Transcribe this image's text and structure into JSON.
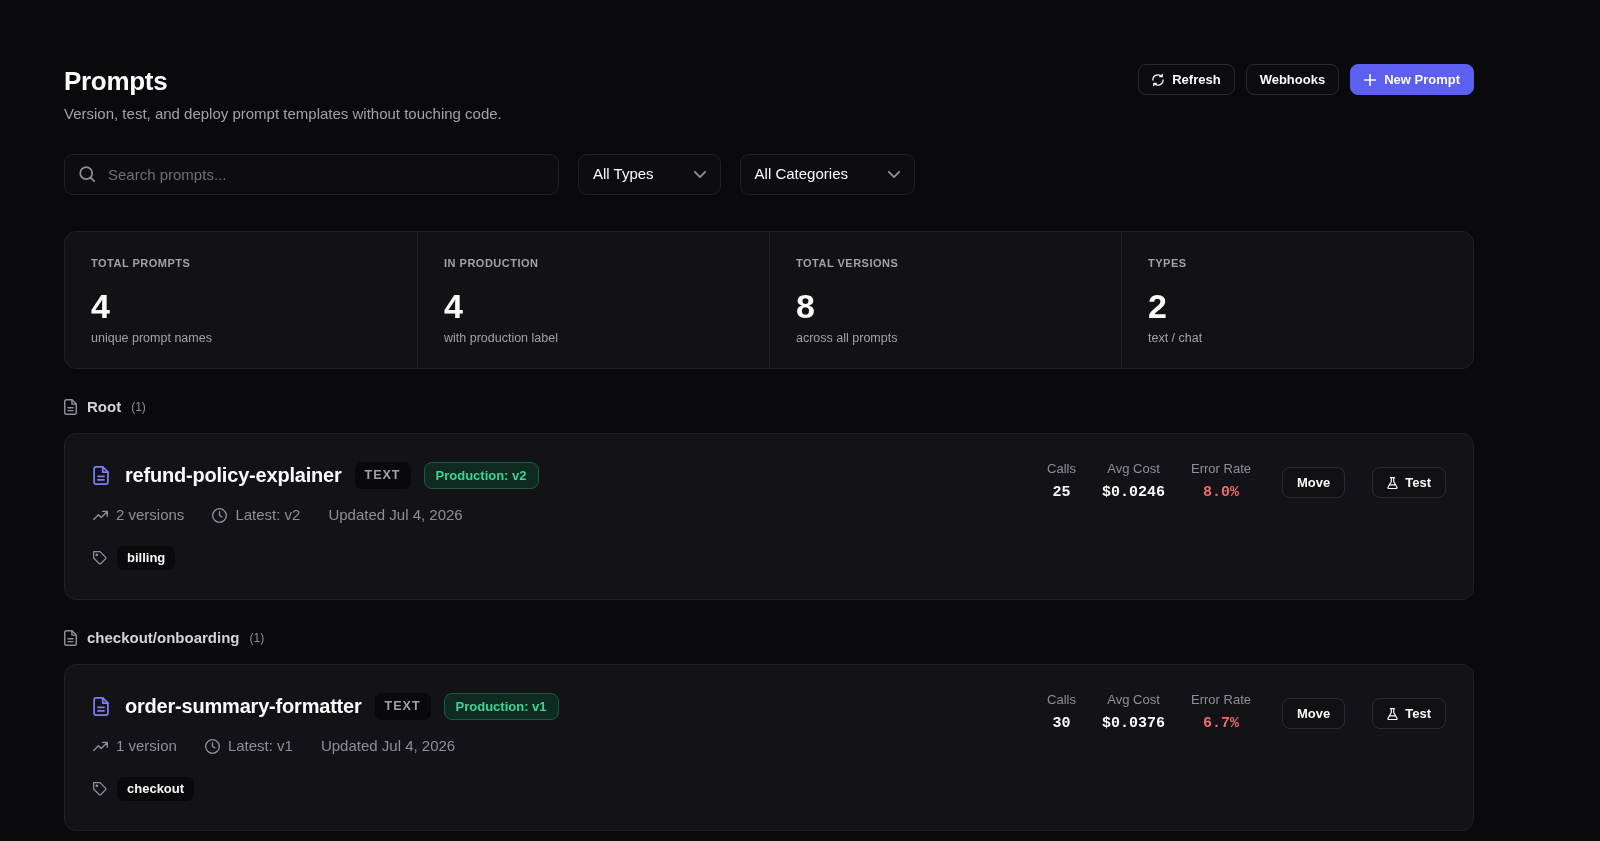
{
  "header": {
    "title": "Prompts",
    "subtitle": "Version, test, and deploy prompt templates without touching code.",
    "buttons": [
      {
        "label": "Refresh",
        "kind": "refresh"
      },
      {
        "label": "Webhooks",
        "kind": "plain"
      },
      {
        "label": "New Prompt",
        "kind": "create"
      }
    ]
  },
  "filters": {
    "search": {
      "placeholder": "Search prompts..."
    },
    "dropdowns": [
      {
        "value": "All Types"
      },
      {
        "value": "All Categories"
      }
    ]
  },
  "stats": [
    {
      "label": "TOTAL PROMPTS",
      "value": "4",
      "caption": "unique prompt names"
    },
    {
      "label": "IN PRODUCTION",
      "value": "4",
      "caption": "with production label"
    },
    {
      "label": "TOTAL VERSIONS",
      "value": "8",
      "caption": "across all prompts"
    },
    {
      "label": "TYPES",
      "value": "2",
      "caption": "text / chat"
    }
  ],
  "groups": [
    {
      "name": "Root",
      "count": "(1)",
      "prompts": [
        {
          "name": "refund-policy-explainer",
          "type": "TEXT",
          "production": "Production: v2",
          "versions": "2 versions",
          "latest": "Latest: v2",
          "updated": "Updated Jul 4, 2026",
          "tags": [
            "billing"
          ],
          "metrics": [
            {
              "label": "Calls",
              "value": "25",
              "kind": "count"
            },
            {
              "label": "Avg Cost",
              "value": "$0.0246",
              "kind": "cost"
            },
            {
              "label": "Error Rate",
              "value": "8.0%",
              "kind": "error"
            }
          ],
          "actions": [
            {
              "label": "Move",
              "kind": "move"
            },
            {
              "label": "Test",
              "kind": "test"
            }
          ]
        }
      ]
    },
    {
      "name": "checkout/onboarding",
      "count": "(1)",
      "prompts": [
        {
          "name": "order-summary-formatter",
          "type": "TEXT",
          "production": "Production: v1",
          "versions": "1 version",
          "latest": "Latest: v1",
          "updated": "Updated Jul 4, 2026",
          "tags": [
            "checkout"
          ],
          "metrics": [
            {
              "label": "Calls",
              "value": "30",
              "kind": "count"
            },
            {
              "label": "Avg Cost",
              "value": "$0.0376",
              "kind": "cost"
            },
            {
              "label": "Error Rate",
              "value": "6.7%",
              "kind": "error"
            }
          ],
          "actions": [
            {
              "label": "Move",
              "kind": "move"
            },
            {
              "label": "Test",
              "kind": "test"
            }
          ]
        }
      ]
    }
  ]
}
